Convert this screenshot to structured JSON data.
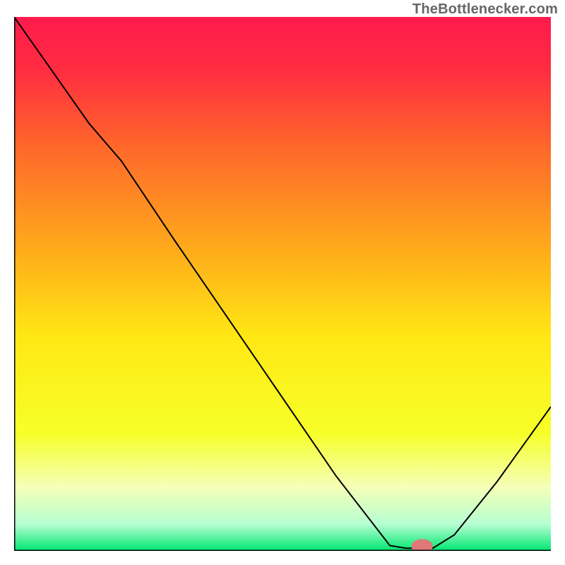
{
  "watermark": "TheBottlenecker.com",
  "chart_data": {
    "type": "line",
    "title": "",
    "xlabel": "",
    "ylabel": "",
    "xlim": [
      0,
      100
    ],
    "ylim": [
      0,
      100
    ],
    "gradient_stops": [
      {
        "offset": 0.0,
        "color": "#ff1a4d"
      },
      {
        "offset": 0.1,
        "color": "#ff2d40"
      },
      {
        "offset": 0.25,
        "color": "#ff6a2a"
      },
      {
        "offset": 0.45,
        "color": "#ffb01a"
      },
      {
        "offset": 0.6,
        "color": "#ffe814"
      },
      {
        "offset": 0.78,
        "color": "#f7ff29"
      },
      {
        "offset": 0.88,
        "color": "#f5ffb7"
      },
      {
        "offset": 0.95,
        "color": "#b6ffd2"
      },
      {
        "offset": 1.0,
        "color": "#00e770"
      }
    ],
    "series": [
      {
        "name": "curve",
        "points": [
          {
            "x": 0.0,
            "y": 100.0
          },
          {
            "x": 14.0,
            "y": 80.0
          },
          {
            "x": 20.0,
            "y": 73.0
          },
          {
            "x": 30.0,
            "y": 58.0
          },
          {
            "x": 45.0,
            "y": 36.0
          },
          {
            "x": 60.0,
            "y": 14.0
          },
          {
            "x": 70.0,
            "y": 1.0
          },
          {
            "x": 73.0,
            "y": 0.5
          },
          {
            "x": 78.0,
            "y": 0.5
          },
          {
            "x": 82.0,
            "y": 3.0
          },
          {
            "x": 90.0,
            "y": 13.0
          },
          {
            "x": 100.0,
            "y": 27.0
          }
        ]
      }
    ],
    "marker": {
      "x_start": 73.0,
      "x_end": 79.0,
      "y": 0.9,
      "rx": 2.0,
      "ry": 1.3,
      "color": "#e07878"
    },
    "axes": {
      "left": true,
      "bottom": true,
      "color": "#000000",
      "width": 3
    }
  }
}
